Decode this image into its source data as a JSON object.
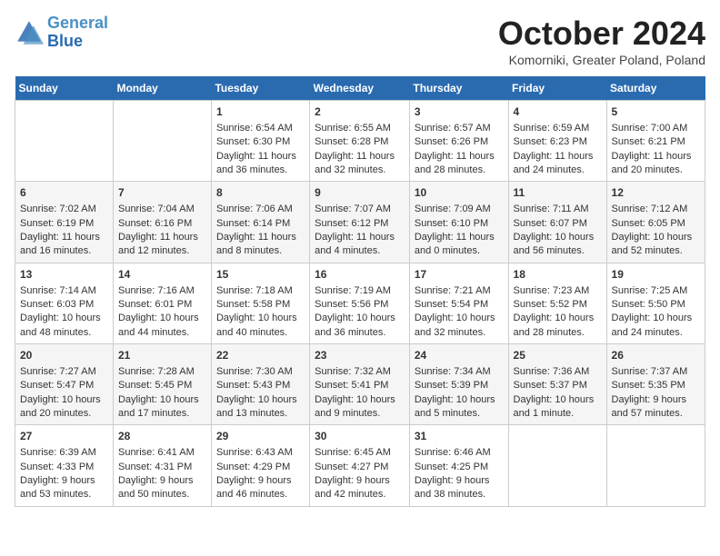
{
  "header": {
    "logo_line1": "General",
    "logo_line2": "Blue",
    "month_title": "October 2024",
    "subtitle": "Komorniki, Greater Poland, Poland"
  },
  "days_of_week": [
    "Sunday",
    "Monday",
    "Tuesday",
    "Wednesday",
    "Thursday",
    "Friday",
    "Saturday"
  ],
  "weeks": [
    [
      {
        "day": "",
        "info": ""
      },
      {
        "day": "",
        "info": ""
      },
      {
        "day": "1",
        "info": "Sunrise: 6:54 AM\nSunset: 6:30 PM\nDaylight: 11 hours and 36 minutes."
      },
      {
        "day": "2",
        "info": "Sunrise: 6:55 AM\nSunset: 6:28 PM\nDaylight: 11 hours and 32 minutes."
      },
      {
        "day": "3",
        "info": "Sunrise: 6:57 AM\nSunset: 6:26 PM\nDaylight: 11 hours and 28 minutes."
      },
      {
        "day": "4",
        "info": "Sunrise: 6:59 AM\nSunset: 6:23 PM\nDaylight: 11 hours and 24 minutes."
      },
      {
        "day": "5",
        "info": "Sunrise: 7:00 AM\nSunset: 6:21 PM\nDaylight: 11 hours and 20 minutes."
      }
    ],
    [
      {
        "day": "6",
        "info": "Sunrise: 7:02 AM\nSunset: 6:19 PM\nDaylight: 11 hours and 16 minutes."
      },
      {
        "day": "7",
        "info": "Sunrise: 7:04 AM\nSunset: 6:16 PM\nDaylight: 11 hours and 12 minutes."
      },
      {
        "day": "8",
        "info": "Sunrise: 7:06 AM\nSunset: 6:14 PM\nDaylight: 11 hours and 8 minutes."
      },
      {
        "day": "9",
        "info": "Sunrise: 7:07 AM\nSunset: 6:12 PM\nDaylight: 11 hours and 4 minutes."
      },
      {
        "day": "10",
        "info": "Sunrise: 7:09 AM\nSunset: 6:10 PM\nDaylight: 11 hours and 0 minutes."
      },
      {
        "day": "11",
        "info": "Sunrise: 7:11 AM\nSunset: 6:07 PM\nDaylight: 10 hours and 56 minutes."
      },
      {
        "day": "12",
        "info": "Sunrise: 7:12 AM\nSunset: 6:05 PM\nDaylight: 10 hours and 52 minutes."
      }
    ],
    [
      {
        "day": "13",
        "info": "Sunrise: 7:14 AM\nSunset: 6:03 PM\nDaylight: 10 hours and 48 minutes."
      },
      {
        "day": "14",
        "info": "Sunrise: 7:16 AM\nSunset: 6:01 PM\nDaylight: 10 hours and 44 minutes."
      },
      {
        "day": "15",
        "info": "Sunrise: 7:18 AM\nSunset: 5:58 PM\nDaylight: 10 hours and 40 minutes."
      },
      {
        "day": "16",
        "info": "Sunrise: 7:19 AM\nSunset: 5:56 PM\nDaylight: 10 hours and 36 minutes."
      },
      {
        "day": "17",
        "info": "Sunrise: 7:21 AM\nSunset: 5:54 PM\nDaylight: 10 hours and 32 minutes."
      },
      {
        "day": "18",
        "info": "Sunrise: 7:23 AM\nSunset: 5:52 PM\nDaylight: 10 hours and 28 minutes."
      },
      {
        "day": "19",
        "info": "Sunrise: 7:25 AM\nSunset: 5:50 PM\nDaylight: 10 hours and 24 minutes."
      }
    ],
    [
      {
        "day": "20",
        "info": "Sunrise: 7:27 AM\nSunset: 5:47 PM\nDaylight: 10 hours and 20 minutes."
      },
      {
        "day": "21",
        "info": "Sunrise: 7:28 AM\nSunset: 5:45 PM\nDaylight: 10 hours and 17 minutes."
      },
      {
        "day": "22",
        "info": "Sunrise: 7:30 AM\nSunset: 5:43 PM\nDaylight: 10 hours and 13 minutes."
      },
      {
        "day": "23",
        "info": "Sunrise: 7:32 AM\nSunset: 5:41 PM\nDaylight: 10 hours and 9 minutes."
      },
      {
        "day": "24",
        "info": "Sunrise: 7:34 AM\nSunset: 5:39 PM\nDaylight: 10 hours and 5 minutes."
      },
      {
        "day": "25",
        "info": "Sunrise: 7:36 AM\nSunset: 5:37 PM\nDaylight: 10 hours and 1 minute."
      },
      {
        "day": "26",
        "info": "Sunrise: 7:37 AM\nSunset: 5:35 PM\nDaylight: 9 hours and 57 minutes."
      }
    ],
    [
      {
        "day": "27",
        "info": "Sunrise: 6:39 AM\nSunset: 4:33 PM\nDaylight: 9 hours and 53 minutes."
      },
      {
        "day": "28",
        "info": "Sunrise: 6:41 AM\nSunset: 4:31 PM\nDaylight: 9 hours and 50 minutes."
      },
      {
        "day": "29",
        "info": "Sunrise: 6:43 AM\nSunset: 4:29 PM\nDaylight: 9 hours and 46 minutes."
      },
      {
        "day": "30",
        "info": "Sunrise: 6:45 AM\nSunset: 4:27 PM\nDaylight: 9 hours and 42 minutes."
      },
      {
        "day": "31",
        "info": "Sunrise: 6:46 AM\nSunset: 4:25 PM\nDaylight: 9 hours and 38 minutes."
      },
      {
        "day": "",
        "info": ""
      },
      {
        "day": "",
        "info": ""
      }
    ]
  ]
}
